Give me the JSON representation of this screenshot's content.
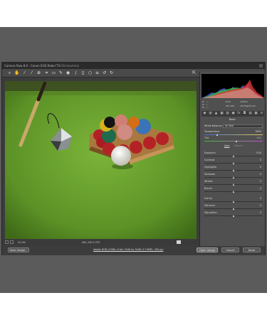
{
  "window": {
    "title": "Camera Raw 8.0 - Canon EOS Rebel T3i",
    "menu1": "Window",
    "menu2": "Help"
  },
  "toolbar": {
    "tools": [
      "zoom-icon",
      "hand-icon",
      "white-balance-icon",
      "color-sampler-icon",
      "targeted-adjust-icon",
      "crop-icon",
      "straighten-icon",
      "spot-removal-icon",
      "red-eye-icon",
      "adjustment-brush-icon",
      "graduated-filter-icon",
      "radial-filter-icon",
      "preferences-icon",
      "rotate-left-icon",
      "rotate-right-icon"
    ],
    "right_icon": "fullscreen-icon"
  },
  "histogram": {
    "r_label": "R:",
    "g_label": "G:",
    "b_label": "B:",
    "r_val": "---",
    "g_val": "---",
    "b_val": "---",
    "aperture": "f/5.6",
    "shutter": "1/250 s",
    "iso": "ISO 400",
    "lens": "18-55@18 mm"
  },
  "panel": {
    "section": "Basic",
    "white_balance_label": "White Balance:",
    "white_balance_value": "As Shot",
    "temperature_label": "Temperature",
    "temperature_value": "3800",
    "tint_label": "Tint",
    "tint_value": "+11",
    "auto_label": "Auto",
    "default_label": "Default",
    "sliders": [
      {
        "label": "Exposure",
        "value": "0.00",
        "pos": 0.5
      },
      {
        "label": "Contrast",
        "value": "0",
        "pos": 0.5
      },
      {
        "label": "Highlights",
        "value": "0",
        "pos": 0.5
      },
      {
        "label": "Shadows",
        "value": "0",
        "pos": 0.5
      },
      {
        "label": "Whites",
        "value": "0",
        "pos": 0.5
      },
      {
        "label": "Blacks",
        "value": "0",
        "pos": 0.5
      },
      {
        "label": "Clarity",
        "value": "0",
        "pos": 0.5
      },
      {
        "label": "Vibrance",
        "value": "0",
        "pos": 0.5
      },
      {
        "label": "Saturation",
        "value": "0",
        "pos": 0.5
      }
    ]
  },
  "status": {
    "zoom": "20.4%",
    "filename": "IMG_9611.CR2"
  },
  "footer": {
    "save_label": "Save Image...",
    "workflow_link": "Adobe RGB (1998); 8 bit; 5184 by 3456 (17.9MP); 300 ppi",
    "open_label": "Open Image",
    "cancel_label": "Cancel",
    "done_label": "Done"
  }
}
